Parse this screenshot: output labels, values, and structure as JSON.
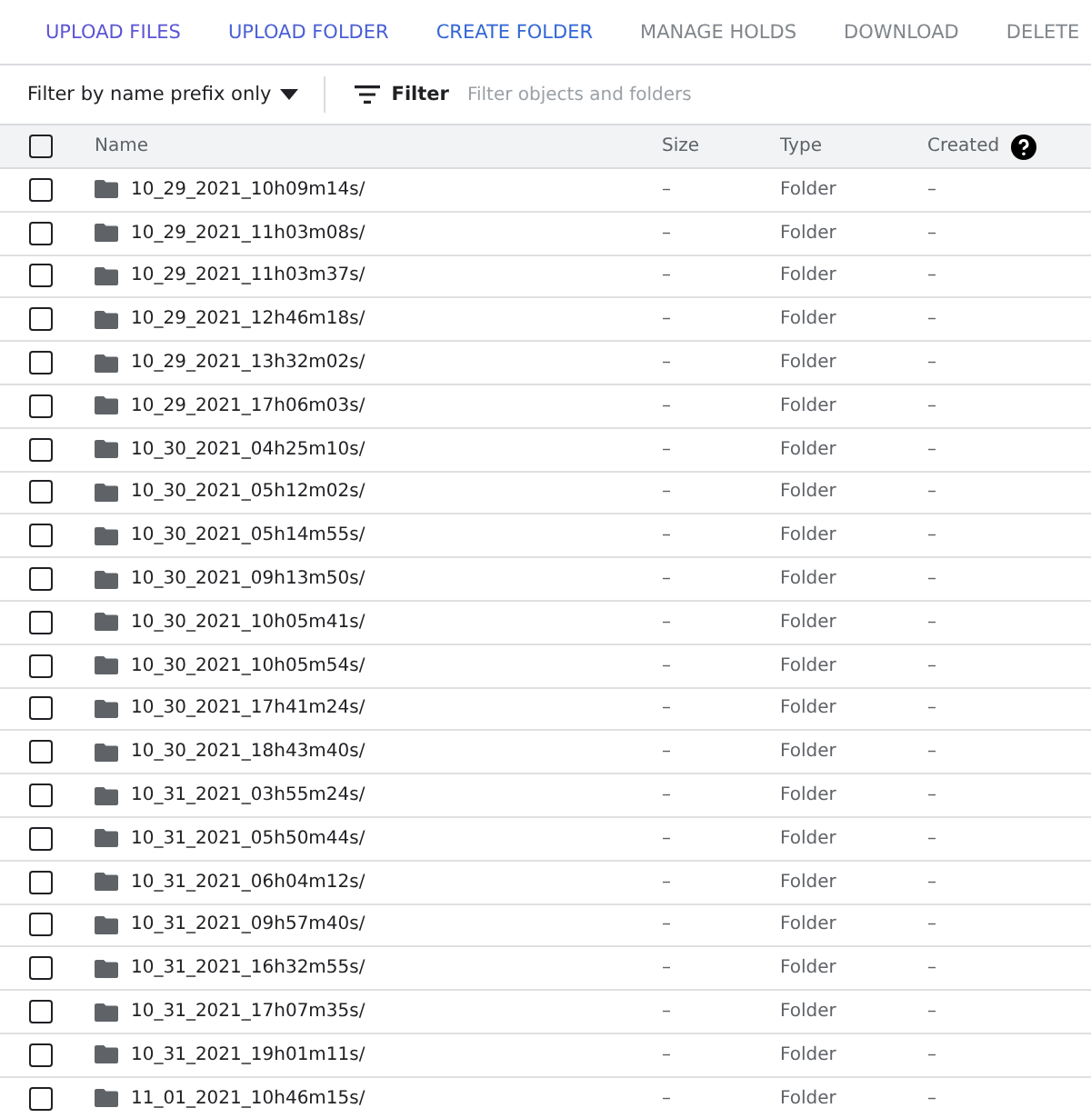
{
  "toolbar": [
    {
      "label": "UPLOAD FILES",
      "disabled": false,
      "color": "#5c55d6"
    },
    {
      "label": "UPLOAD FOLDER",
      "disabled": false,
      "color": "#4a5fd6"
    },
    {
      "label": "CREATE FOLDER",
      "disabled": false,
      "color": "#3367d6"
    },
    {
      "label": "MANAGE HOLDS",
      "disabled": true
    },
    {
      "label": "DOWNLOAD",
      "disabled": true
    },
    {
      "label": "DELETE",
      "disabled": true
    }
  ],
  "filter_bar": {
    "mode": "Filter by name prefix only",
    "filter_label": "Filter",
    "placeholder": "Filter objects and folders"
  },
  "table": {
    "columns": [
      "Name",
      "Size",
      "Type",
      "Created"
    ],
    "all_checked": false,
    "rows": [
      {
        "name": "10_29_2021_10h09m14s/",
        "size": "–",
        "type": "Folder",
        "created": "–",
        "checked": false
      },
      {
        "name": "10_29_2021_11h03m08s/",
        "size": "–",
        "type": "Folder",
        "created": "–",
        "checked": false
      },
      {
        "name": "10_29_2021_11h03m37s/",
        "size": "–",
        "type": "Folder",
        "created": "–",
        "checked": false
      },
      {
        "name": "10_29_2021_12h46m18s/",
        "size": "–",
        "type": "Folder",
        "created": "–",
        "checked": false
      },
      {
        "name": "10_29_2021_13h32m02s/",
        "size": "–",
        "type": "Folder",
        "created": "–",
        "checked": false
      },
      {
        "name": "10_29_2021_17h06m03s/",
        "size": "–",
        "type": "Folder",
        "created": "–",
        "checked": false
      },
      {
        "name": "10_30_2021_04h25m10s/",
        "size": "–",
        "type": "Folder",
        "created": "–",
        "checked": false
      },
      {
        "name": "10_30_2021_05h12m02s/",
        "size": "–",
        "type": "Folder",
        "created": "–",
        "checked": false
      },
      {
        "name": "10_30_2021_05h14m55s/",
        "size": "–",
        "type": "Folder",
        "created": "–",
        "checked": false
      },
      {
        "name": "10_30_2021_09h13m50s/",
        "size": "–",
        "type": "Folder",
        "created": "–",
        "checked": false
      },
      {
        "name": "10_30_2021_10h05m41s/",
        "size": "–",
        "type": "Folder",
        "created": "–",
        "checked": false
      },
      {
        "name": "10_30_2021_10h05m54s/",
        "size": "–",
        "type": "Folder",
        "created": "–",
        "checked": false
      },
      {
        "name": "10_30_2021_17h41m24s/",
        "size": "–",
        "type": "Folder",
        "created": "–",
        "checked": false
      },
      {
        "name": "10_30_2021_18h43m40s/",
        "size": "–",
        "type": "Folder",
        "created": "–",
        "checked": false
      },
      {
        "name": "10_31_2021_03h55m24s/",
        "size": "–",
        "type": "Folder",
        "created": "–",
        "checked": false
      },
      {
        "name": "10_31_2021_05h50m44s/",
        "size": "–",
        "type": "Folder",
        "created": "–",
        "checked": false
      },
      {
        "name": "10_31_2021_06h04m12s/",
        "size": "–",
        "type": "Folder",
        "created": "–",
        "checked": false
      },
      {
        "name": "10_31_2021_09h57m40s/",
        "size": "–",
        "type": "Folder",
        "created": "–",
        "checked": false
      },
      {
        "name": "10_31_2021_16h32m55s/",
        "size": "–",
        "type": "Folder",
        "created": "–",
        "checked": false
      },
      {
        "name": "10_31_2021_17h07m35s/",
        "size": "–",
        "type": "Folder",
        "created": "–",
        "checked": false
      },
      {
        "name": "10_31_2021_19h01m11s/",
        "size": "–",
        "type": "Folder",
        "created": "–",
        "checked": false
      },
      {
        "name": "11_01_2021_10h46m15s/",
        "size": "–",
        "type": "Folder",
        "created": "–",
        "checked": false
      }
    ]
  }
}
